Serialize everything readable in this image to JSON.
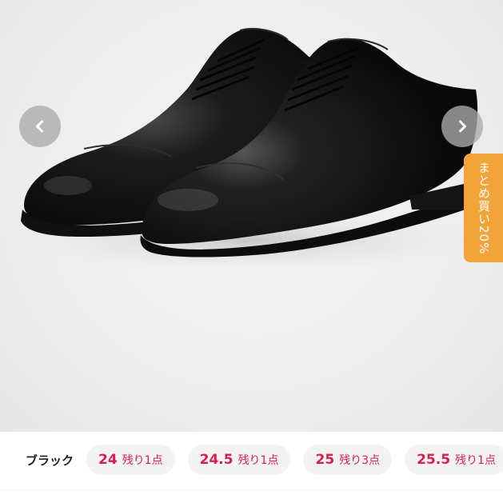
{
  "gallery": {
    "image_alt": "black cap-toe oxford shoes",
    "prev_icon": "chevron-left-icon",
    "next_icon": "chevron-right-icon"
  },
  "promo_tab": {
    "label": "まとめ買い20%",
    "color": "#f2a33a"
  },
  "variants": {
    "color_label": "ブラック",
    "accent": "#d81e4f",
    "sizes": [
      {
        "size": "24",
        "stock": "残り1点"
      },
      {
        "size": "24.5",
        "stock": "残り1点"
      },
      {
        "size": "25",
        "stock": "残り3点"
      },
      {
        "size": "25.5",
        "stock": "残り1点"
      }
    ]
  }
}
